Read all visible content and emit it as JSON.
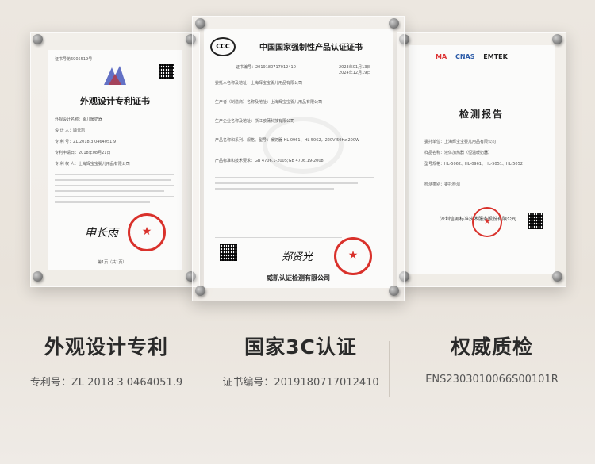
{
  "cert_left": {
    "doc_title": "外观设计专利证书",
    "header_left": "证书号第6905519号",
    "rows": [
      "外观设计名称：婴儿暖奶器",
      "设 计 人：顾元凯",
      "专 利 号：ZL 2018 3 0464051.9",
      "专利申请日：2018年08月21日",
      "专 利 权 人：上海辉宝宝婴儿用品有限公司"
    ],
    "signature": "申长雨",
    "footer": "局长 申长雨",
    "bottom": "第1页（共1页）"
  },
  "cert_center": {
    "doc_title": "中国国家强制性产品认证证书",
    "cert_no_label": "证书编号：2019180717012410",
    "issue": "2023年01月13日",
    "expiry": "2024年12月19日",
    "rows": [
      "委托人名称及地址：上海辉宝宝婴儿用品有限公司",
      "生产者（制造商）名称及地址：上海辉宝宝婴儿用品有限公司",
      "生产企业名称及地址：浙江欧蒲科技有限公司",
      "产品名称和系列、规格、型号：暖奶器 HL-0961、HL-5062，220V 50Hz 200W",
      "产品标准和技术要求：GB 4706.1-2005;GB 4706.19-2008"
    ],
    "footer_org": "威凯认证检测有限公司",
    "signature": "郑贤光"
  },
  "cert_right": {
    "doc_title": "检测报告",
    "logos": [
      "MA",
      "CNAS",
      "EMTEK"
    ],
    "rows": [
      "委托单位：上海辉宝宝婴儿用品有限公司",
      "样品名称：液体加热器（恒温暖奶器）",
      "型号规格：HL-5062、HL-0961、HL-5051、HL-5052",
      "检测类别：委托检测"
    ],
    "org": "深圳信测标准技术服务股份有限公司"
  },
  "captions": [
    {
      "title": "外观设计专利",
      "sub": "专利号：ZL 2018 3 0464051.9"
    },
    {
      "title": "国家3C认证",
      "sub": "证书编号：2019180717012410"
    },
    {
      "title": "权威质检",
      "sub": "ENS2303010066S00101R"
    }
  ]
}
